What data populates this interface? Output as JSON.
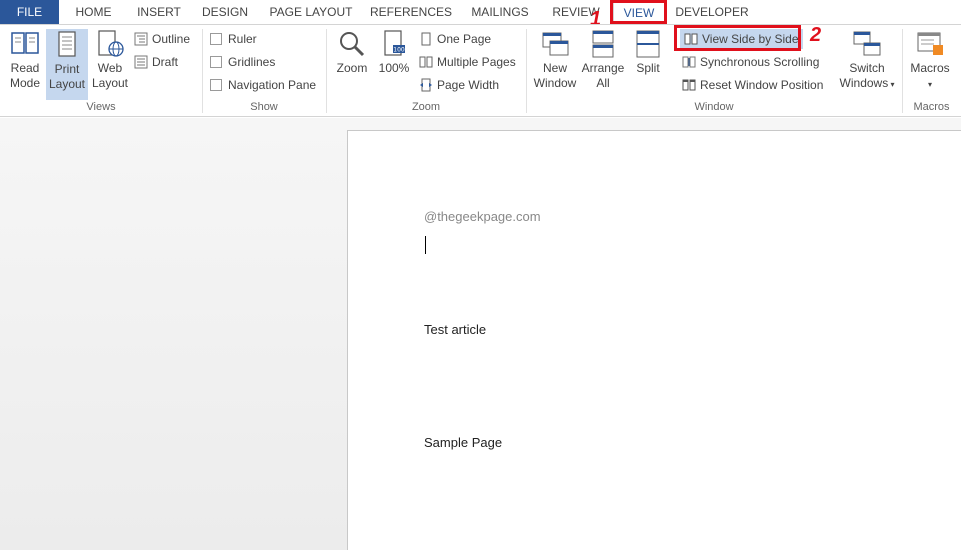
{
  "tabs": {
    "file": "FILE",
    "home": "HOME",
    "insert": "INSERT",
    "design": "DESIGN",
    "page_layout": "PAGE LAYOUT",
    "references": "REFERENCES",
    "mailings": "MAILINGS",
    "review": "REVIEW",
    "view": "VIEW",
    "developer": "DEVELOPER"
  },
  "views": {
    "label": "Views",
    "read_mode": [
      "Read",
      "Mode"
    ],
    "print_layout": [
      "Print",
      "Layout"
    ],
    "web_layout": [
      "Web",
      "Layout"
    ],
    "outline": "Outline",
    "draft": "Draft"
  },
  "show": {
    "label": "Show",
    "ruler": "Ruler",
    "gridlines": "Gridlines",
    "navigation_pane": "Navigation Pane"
  },
  "zoom": {
    "label": "Zoom",
    "zoom": "Zoom",
    "hundred": "100%",
    "one_page": "One Page",
    "multiple_pages": "Multiple Pages",
    "page_width": "Page Width"
  },
  "window": {
    "label": "Window",
    "new_window": [
      "New",
      "Window"
    ],
    "arrange_all": [
      "Arrange",
      "All"
    ],
    "split": "Split",
    "view_side_by_side": "View Side by Side",
    "synchronous_scrolling": "Synchronous Scrolling",
    "reset_window_position": "Reset Window Position",
    "switch_windows": [
      "Switch",
      "Windows"
    ]
  },
  "macros": {
    "label": "Macros",
    "macros": "Macros"
  },
  "annotations": {
    "marker1": "1",
    "marker2": "2"
  },
  "document": {
    "watermark": "@thegeekpage.com",
    "line1": "Test article",
    "line2": "Sample Page"
  },
  "colors": {
    "accent": "#2b579a",
    "highlight": "#e0101c",
    "selected_bg": "#c5d7ee"
  }
}
